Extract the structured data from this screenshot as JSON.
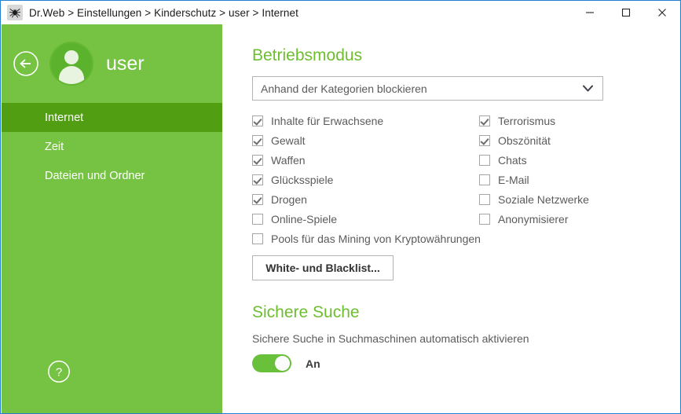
{
  "window": {
    "breadcrumb": "Dr.Web > Einstellungen > Kinderschutz > user > Internet",
    "app_icon": "spider-icon",
    "controls": {
      "minimize": "minimize-icon",
      "maximize": "maximize-icon",
      "close": "close-icon"
    },
    "border_color": "#2280d0"
  },
  "sidebar": {
    "back_icon": "back-arrow-icon",
    "avatar_icon": "user-avatar-icon",
    "user_name": "user",
    "background_color": "#76c344",
    "selected_color": "#519e13",
    "help_icon": "help-question-icon",
    "items": [
      {
        "label": "Internet",
        "selected": true
      },
      {
        "label": "Zeit",
        "selected": false
      },
      {
        "label": "Dateien und Ordner",
        "selected": false
      }
    ]
  },
  "main": {
    "heading_color": "#6dbe2e",
    "betriebsmodus": {
      "title": "Betriebsmodus",
      "dropdown": {
        "value": "Anhand der Kategorien blockieren",
        "arrow_icon": "chevron-down-icon"
      },
      "categories_left": [
        {
          "label": "Inhalte für Erwachsene",
          "checked": true
        },
        {
          "label": "Gewalt",
          "checked": true
        },
        {
          "label": "Waffen",
          "checked": true
        },
        {
          "label": "Glücksspiele",
          "checked": true
        },
        {
          "label": "Drogen",
          "checked": true
        },
        {
          "label": "Online-Spiele",
          "checked": false
        },
        {
          "label": "Pools für das Mining von Kryptowährungen",
          "checked": false
        }
      ],
      "categories_right": [
        {
          "label": "Terrorismus",
          "checked": true
        },
        {
          "label": "Obszönität",
          "checked": true
        },
        {
          "label": "Chats",
          "checked": false
        },
        {
          "label": "E-Mail",
          "checked": false
        },
        {
          "label": "Soziale Netzwerke",
          "checked": false
        },
        {
          "label": "Anonymisierer",
          "checked": false
        }
      ],
      "blacklist_button": "White- und Blacklist..."
    },
    "sichere_suche": {
      "title": "Sichere Suche",
      "description": "Sichere Suche in Suchmaschinen automatisch aktivieren",
      "toggle": {
        "state_label": "An",
        "on": true,
        "on_color": "#69c03a"
      }
    }
  }
}
